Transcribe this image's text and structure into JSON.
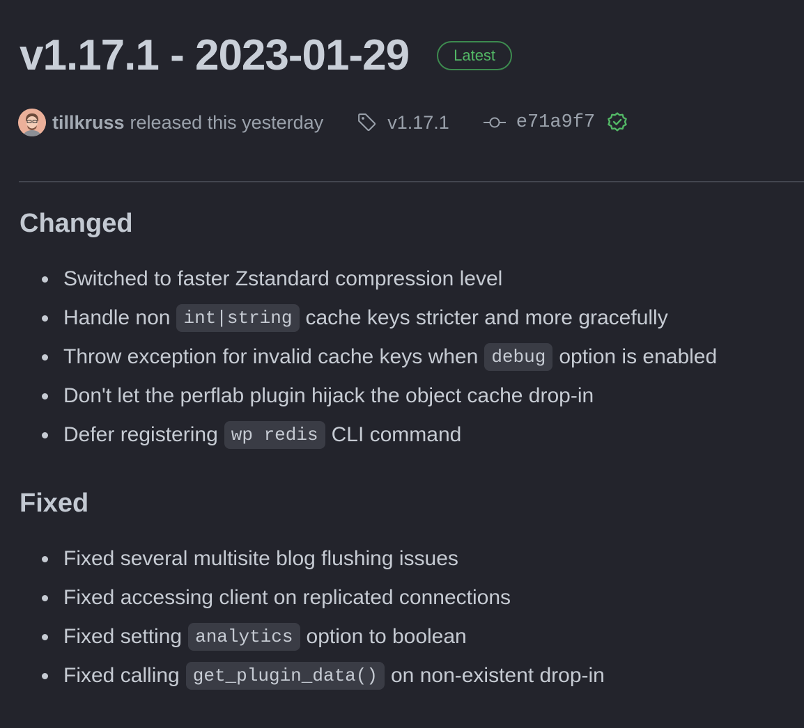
{
  "release": {
    "title": "v1.17.1 - 2023-01-29",
    "badge": "Latest",
    "author": "tillkruss",
    "released_text": "released this yesterday",
    "tag": "v1.17.1",
    "commit": "e71a9f7",
    "verified": true,
    "icons": {
      "avatar": "avatar",
      "tag": "tag-icon",
      "commit": "git-commit-icon",
      "verified": "verified-check-icon"
    }
  },
  "sections": [
    {
      "heading": "Changed",
      "items": [
        {
          "text": "Switched to faster Zstandard compression level"
        },
        {
          "before": "Handle non",
          "code": "int|string",
          "after": "cache keys stricter and more gracefully"
        },
        {
          "before": "Throw exception for invalid cache keys when",
          "code": "debug",
          "after": "option is enabled"
        },
        {
          "text": "Don't let the perflab plugin hijack the object cache drop-in"
        },
        {
          "before": "Defer registering",
          "code": "wp redis",
          "after": "CLI command"
        }
      ]
    },
    {
      "heading": "Fixed",
      "items": [
        {
          "text": "Fixed several multisite blog flushing issues"
        },
        {
          "text": "Fixed accessing client on replicated connections"
        },
        {
          "before": "Fixed setting",
          "code": "analytics",
          "after": "option to boolean"
        },
        {
          "before": "Fixed calling",
          "code": "get_plugin_data()",
          "after": "on non-existent drop-in"
        }
      ]
    }
  ],
  "colors": {
    "background": "#23242c",
    "text": "#c6cbd3",
    "muted": "#9aa1ab",
    "badge_green": "#53b866",
    "code_bg": "#3a3c45",
    "divider": "#43464f"
  }
}
